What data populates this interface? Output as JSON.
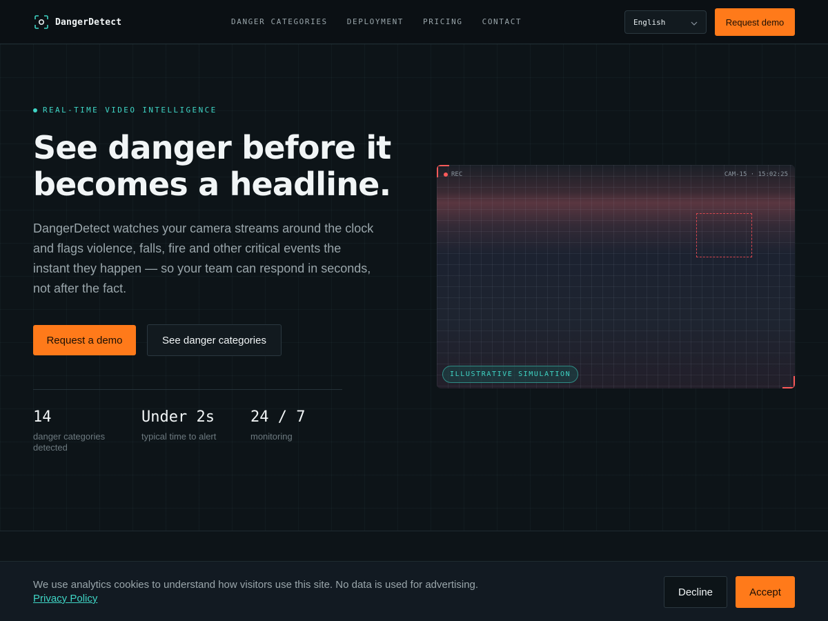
{
  "header": {
    "brand": "DangerDetect",
    "nav": [
      "DANGER CATEGORIES",
      "DEPLOYMENT",
      "PRICING",
      "CONTACT"
    ],
    "language": "English",
    "cta": "Request demo"
  },
  "hero": {
    "eyebrow": "REAL-TIME VIDEO INTELLIGENCE",
    "headline": "See danger before it becomes a headline.",
    "lead": "DangerDetect watches your camera streams around the clock and flags violence, falls, fire and other critical events the instant they happen — so your team can respond in seconds, not after the fact.",
    "primary_cta": "Request a demo",
    "secondary_cta": "See danger categories"
  },
  "stats": [
    {
      "value": "14",
      "label": "danger categories detected"
    },
    {
      "value": "Under 2s",
      "label": "typical time to alert"
    },
    {
      "value": "24 / 7",
      "label": "monitoring"
    }
  ],
  "camera": {
    "rec_label": "REC",
    "cam_id": "CAM-15 · 15:02:25",
    "badge": "ILLUSTRATIVE SIMULATION"
  },
  "cookie": {
    "message": "We use analytics cookies to understand how visitors use this site. No data is used for advertising.",
    "link": "Privacy Policy",
    "decline": "Decline",
    "accept": "Accept"
  },
  "colors": {
    "accent": "#ff7a1a",
    "teal": "#3fd6c6",
    "alert": "#ff5a5a",
    "background": "#0d1418"
  },
  "icons": [
    "scan-focus-icon",
    "chevron-down-icon",
    "record-dot-icon"
  ]
}
